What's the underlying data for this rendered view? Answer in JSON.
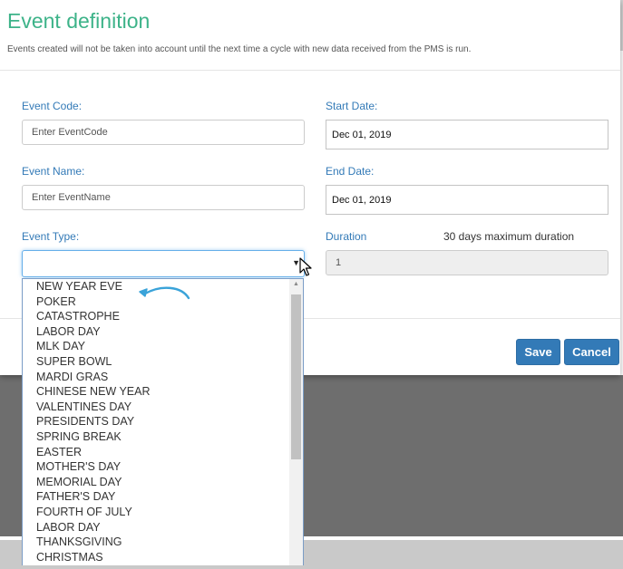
{
  "modal": {
    "title": "Event definition",
    "subtitle": "Events created will not be taken into account until the next time a cycle with new data received from the PMS is run."
  },
  "form": {
    "event_code": {
      "label": "Event Code:",
      "placeholder": "Enter EventCode",
      "value": ""
    },
    "event_name": {
      "label": "Event Name:",
      "placeholder": "Enter EventName",
      "value": ""
    },
    "event_type": {
      "label": "Event Type:",
      "selected": ""
    },
    "start_date": {
      "label": "Start Date:",
      "value": "Dec 01, 2019"
    },
    "end_date": {
      "label": "End Date:",
      "value": "Dec 01, 2019"
    },
    "duration": {
      "label": "Duration",
      "note": "30 days maximum duration",
      "value": "1"
    }
  },
  "buttons": {
    "save": "Save",
    "cancel": "Cancel"
  },
  "dropdown": {
    "options": [
      "NEW YEAR EVE",
      "POKER",
      "CATASTROPHE",
      "LABOR DAY",
      "MLK DAY",
      "SUPER BOWL",
      "MARDI GRAS",
      "CHINESE NEW YEAR",
      "VALENTINES DAY",
      "PRESIDENTS DAY",
      "SPRING BREAK",
      "EASTER",
      "MOTHER'S DAY",
      "MEMORIAL DAY",
      "FATHER'S DAY",
      "FOURTH OF JULY",
      "LABOR DAY",
      "THANKSGIVING",
      "CHRISTMAS"
    ],
    "scroll_position": 0
  },
  "icons": {
    "select_arrow": "chevron-down-icon",
    "cursor": "mouse-cursor-icon",
    "annotation": "curved-arrow-icon"
  },
  "colors": {
    "title": "#3db389",
    "label": "#337ab7",
    "button": "#337ab7",
    "annotation_arrow": "#3aa3d9"
  }
}
